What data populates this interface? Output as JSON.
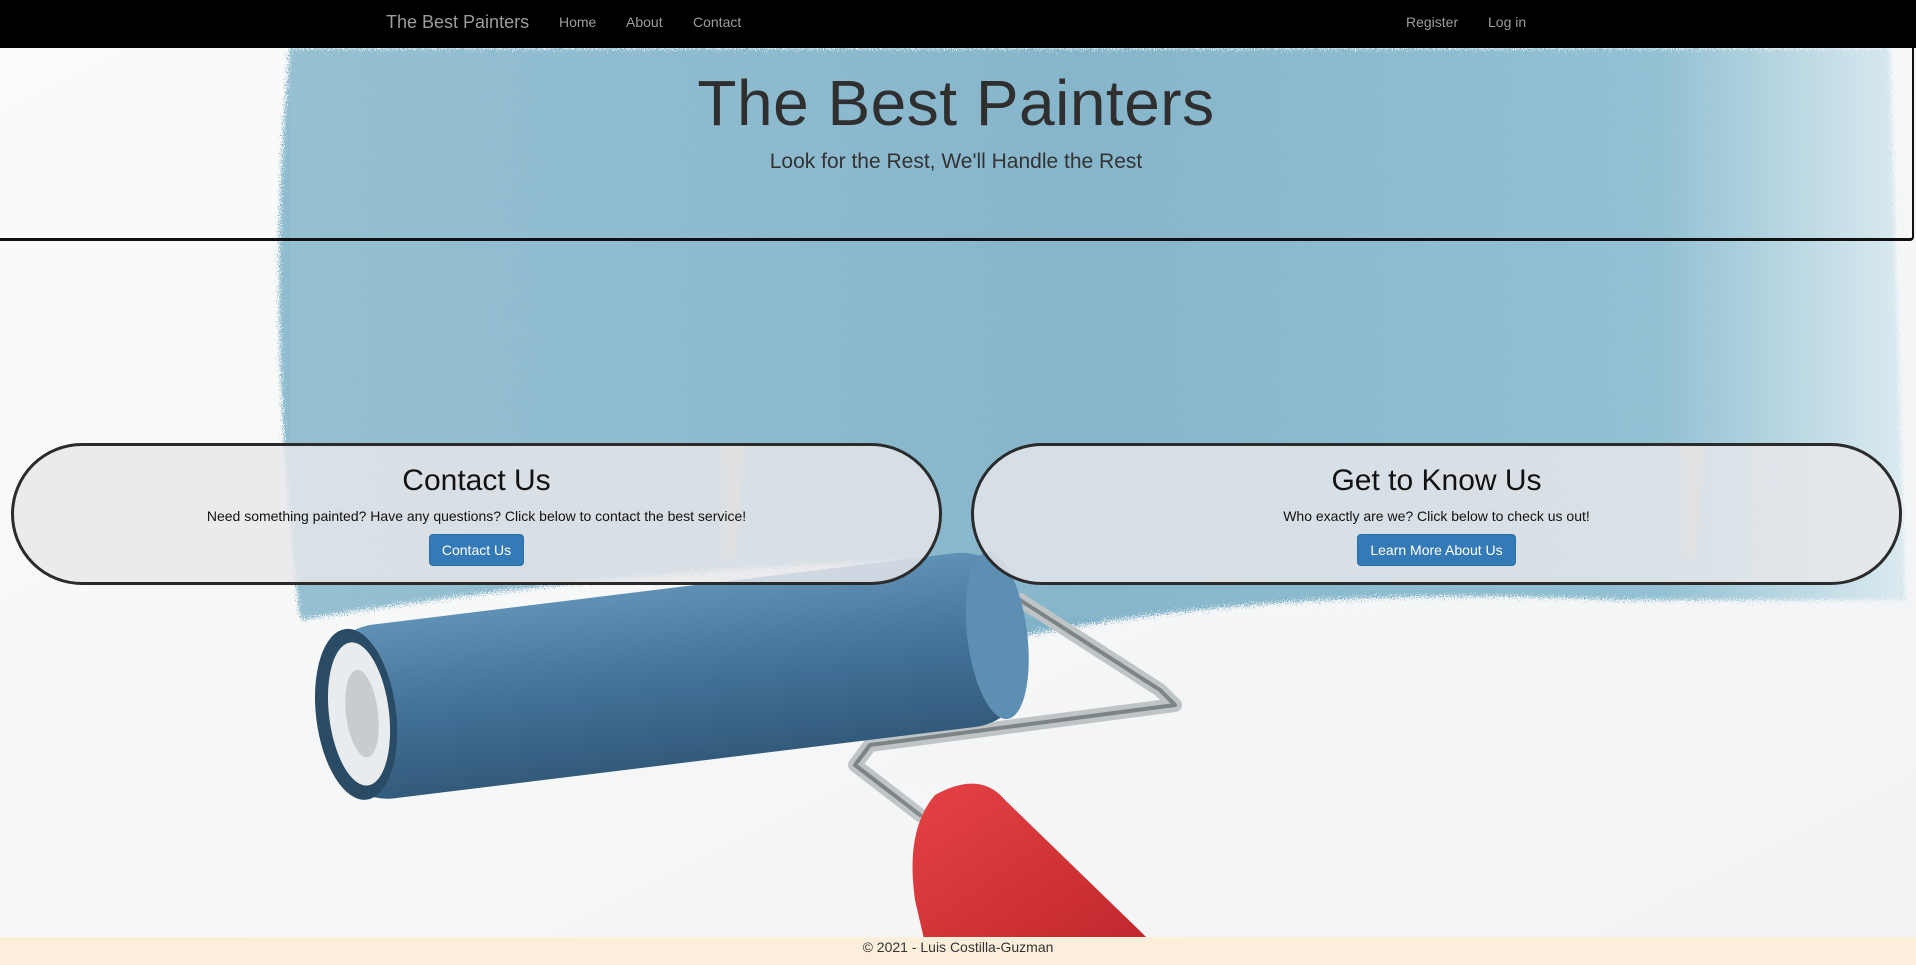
{
  "navbar": {
    "brand": "The Best Painters",
    "links": [
      "Home",
      "About",
      "Contact"
    ],
    "right_links": [
      "Register",
      "Log in"
    ]
  },
  "hero": {
    "title": "The Best Painters",
    "subtitle": "Look for the Rest, We'll Handle the Rest"
  },
  "cards": [
    {
      "title": "Contact Us",
      "text": "Need something painted? Have any questions? Click below to contact the best service!",
      "button": "Contact Us"
    },
    {
      "title": "Get to Know Us",
      "text": "Who exactly are we? Click below to check us out!",
      "button": "Learn More About Us"
    }
  ],
  "footer": {
    "text": "© 2021 - Luis Costilla-Guzman"
  },
  "colors": {
    "navbar_bg": "#000000",
    "nav_text": "#9d9d9d",
    "button_primary": "#337ab7",
    "footer_bg": "#fbeedb",
    "paint_blue": "#7fb0c8",
    "roller_blue": "#3f6f95",
    "handle_red": "#d7262c"
  },
  "icons": [
    "paint-roller-image"
  ]
}
